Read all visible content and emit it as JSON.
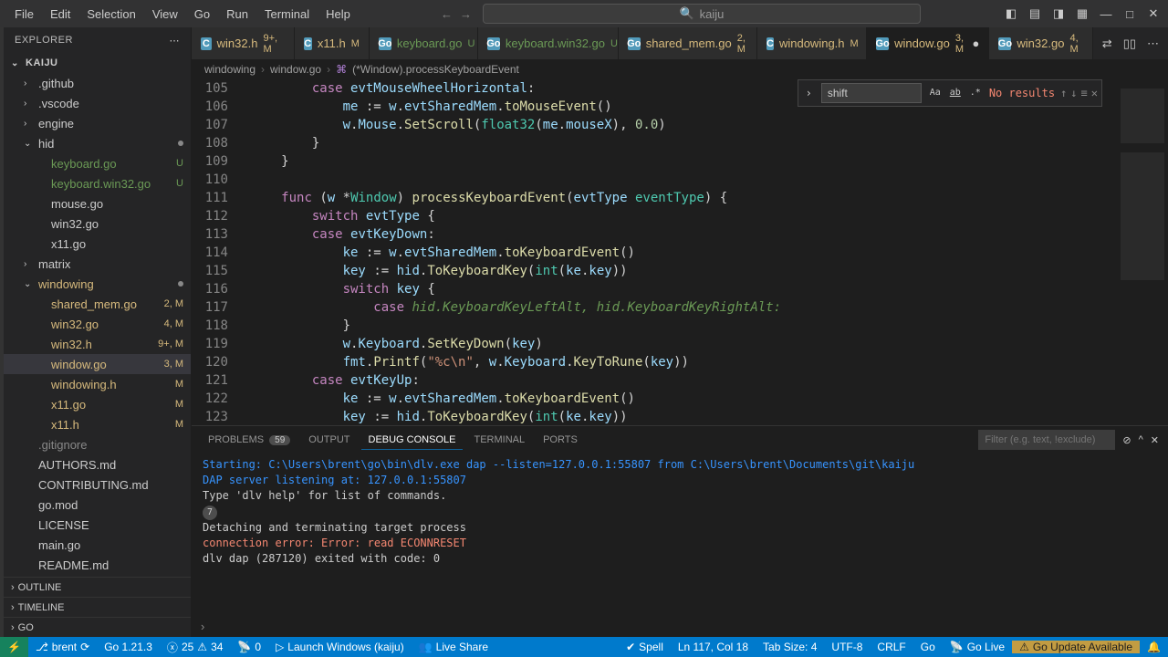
{
  "menu": [
    "File",
    "Edit",
    "Selection",
    "View",
    "Go",
    "Run",
    "Terminal",
    "Help"
  ],
  "search_text": "kaiju",
  "explorer_label": "EXPLORER",
  "project_root": "KAIJU",
  "tree": [
    {
      "label": ".github",
      "indent": 1,
      "chev": "›",
      "cls": ""
    },
    {
      "label": ".vscode",
      "indent": 1,
      "chev": "›",
      "cls": ""
    },
    {
      "label": "engine",
      "indent": 1,
      "chev": "›",
      "cls": ""
    },
    {
      "label": "hid",
      "indent": 1,
      "chev": "⌄",
      "cls": "",
      "dot": true
    },
    {
      "label": "keyboard.go",
      "indent": 2,
      "badge": "U",
      "cls": "untracked"
    },
    {
      "label": "keyboard.win32.go",
      "indent": 2,
      "badge": "U",
      "cls": "untracked"
    },
    {
      "label": "mouse.go",
      "indent": 2,
      "cls": ""
    },
    {
      "label": "win32.go",
      "indent": 2,
      "cls": ""
    },
    {
      "label": "x11.go",
      "indent": 2,
      "cls": ""
    },
    {
      "label": "matrix",
      "indent": 1,
      "chev": "›",
      "cls": ""
    },
    {
      "label": "windowing",
      "indent": 1,
      "chev": "⌄",
      "cls": "mod",
      "dot": true
    },
    {
      "label": "shared_mem.go",
      "indent": 2,
      "badge": "2, M",
      "cls": "mod"
    },
    {
      "label": "win32.go",
      "indent": 2,
      "badge": "4, M",
      "cls": "mod"
    },
    {
      "label": "win32.h",
      "indent": 2,
      "badge": "9+, M",
      "cls": "mod"
    },
    {
      "label": "window.go",
      "indent": 2,
      "badge": "3, M",
      "cls": "mod",
      "selected": true
    },
    {
      "label": "windowing.h",
      "indent": 2,
      "badge": "M",
      "cls": "mod"
    },
    {
      "label": "x11.go",
      "indent": 2,
      "badge": "M",
      "cls": "mod"
    },
    {
      "label": "x11.h",
      "indent": 2,
      "badge": "M",
      "cls": "mod"
    },
    {
      "label": ".gitignore",
      "indent": 1,
      "cls": "dim"
    },
    {
      "label": "AUTHORS.md",
      "indent": 1,
      "cls": ""
    },
    {
      "label": "CONTRIBUTING.md",
      "indent": 1,
      "cls": ""
    },
    {
      "label": "go.mod",
      "indent": 1,
      "cls": ""
    },
    {
      "label": "LICENSE",
      "indent": 1,
      "cls": ""
    },
    {
      "label": "main.go",
      "indent": 1,
      "cls": ""
    },
    {
      "label": "README.md",
      "indent": 1,
      "cls": ""
    }
  ],
  "sidebar_sections": [
    "OUTLINE",
    "TIMELINE",
    "GO"
  ],
  "tabs": [
    {
      "icon": "C",
      "iconbg": "#519aba",
      "name": "win32.h",
      "status": "9+, M",
      "cls": "mod"
    },
    {
      "icon": "C",
      "iconbg": "#519aba",
      "name": "x11.h",
      "status": "M",
      "cls": "mod"
    },
    {
      "icon": "Go",
      "iconbg": "#519aba",
      "name": "keyboard.go",
      "status": "U",
      "cls": "untracked"
    },
    {
      "icon": "Go",
      "iconbg": "#519aba",
      "name": "keyboard.win32.go",
      "status": "U",
      "cls": "untracked"
    },
    {
      "icon": "Go",
      "iconbg": "#519aba",
      "name": "shared_mem.go",
      "status": "2, M",
      "cls": "mod"
    },
    {
      "icon": "C",
      "iconbg": "#519aba",
      "name": "windowing.h",
      "status": "M",
      "cls": "mod"
    },
    {
      "icon": "Go",
      "iconbg": "#519aba",
      "name": "window.go",
      "status": "3, M",
      "cls": "mod",
      "active": true,
      "dirty": true
    },
    {
      "icon": "Go",
      "iconbg": "#519aba",
      "name": "win32.go",
      "status": "4, M",
      "cls": "mod"
    }
  ],
  "breadcrumb": {
    "folder": "windowing",
    "file": "window.go",
    "symbol": "(*Window).processKeyboardEvent"
  },
  "find": {
    "value": "shift",
    "results": "No results"
  },
  "code_start": 105,
  "panel": {
    "tabs": [
      {
        "label": "PROBLEMS",
        "count": "59"
      },
      {
        "label": "OUTPUT"
      },
      {
        "label": "DEBUG CONSOLE",
        "active": true
      },
      {
        "label": "TERMINAL"
      },
      {
        "label": "PORTS"
      }
    ],
    "filter_placeholder": "Filter (e.g. text, !exclude)",
    "lines": [
      {
        "t": "Starting: C:\\Users\\brent\\go\\bin\\dlv.exe dap --listen=127.0.0.1:55807 from C:\\Users\\brent\\Documents\\git\\kaiju",
        "cls": "accent"
      },
      {
        "t": "DAP server listening at: 127.0.0.1:55807",
        "cls": "accent"
      },
      {
        "t": "Type 'dlv help' for list of commands.",
        "cls": ""
      },
      {
        "circ": "7"
      },
      {
        "t": "Detaching and terminating target process",
        "cls": ""
      },
      {
        "t": "connection error: Error: read ECONNRESET",
        "cls": "err"
      },
      {
        "t": "dlv dap (287120) exited with code: 0",
        "cls": ""
      }
    ]
  },
  "status": {
    "remote_icon": "⚡",
    "branch": "brent",
    "go_version": "Go 1.21.3",
    "errs": "25",
    "warns": "34",
    "port": "0",
    "debug": "Launch Windows (kaiju)",
    "live_share": "Live Share",
    "spell": "Spell",
    "cursor": "Ln 117, Col 18",
    "tab": "Tab Size: 4",
    "enc": "UTF-8",
    "eol": "CRLF",
    "lang": "Go",
    "golive": "Go Live",
    "update": "Go Update Available",
    "bell": "🔔"
  }
}
